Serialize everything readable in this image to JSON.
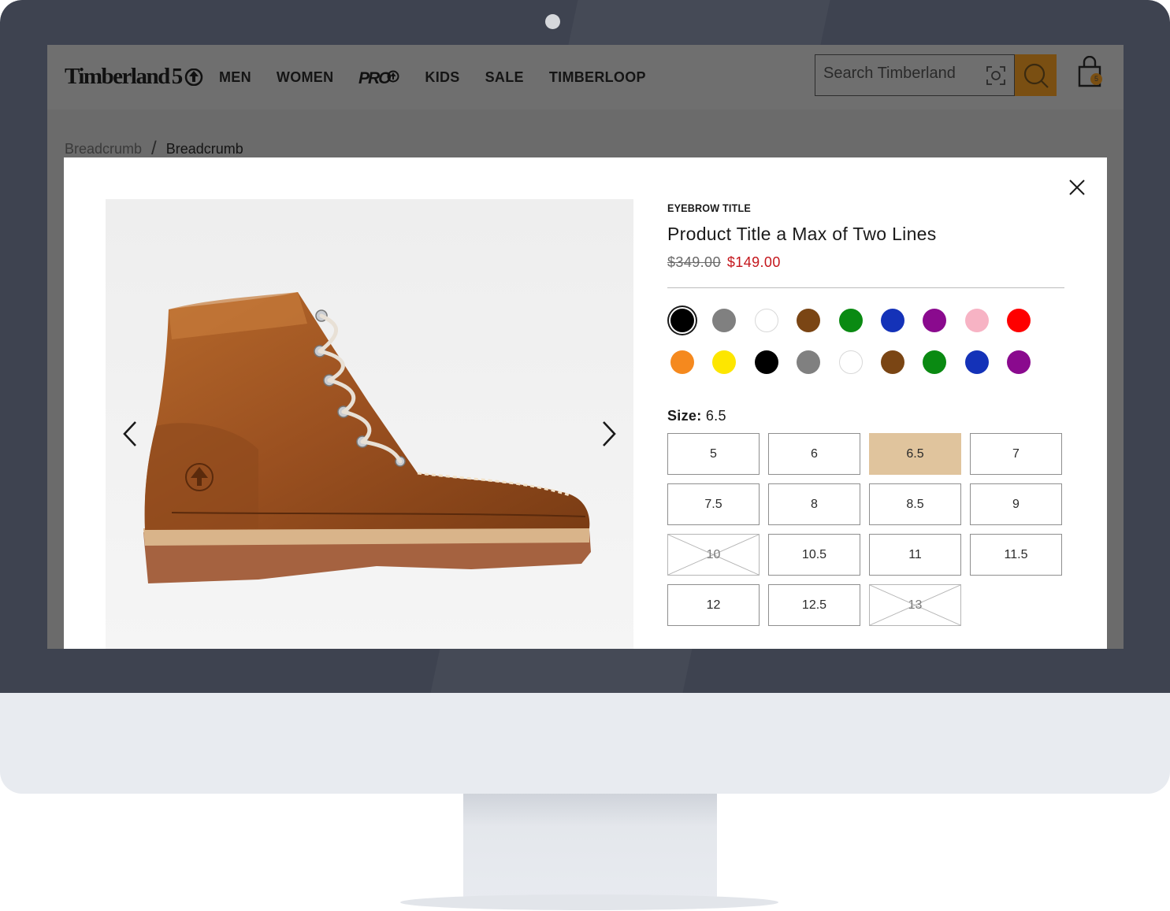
{
  "header": {
    "logo_text": "Timberland",
    "logo_suffix": "5",
    "nav_items": [
      "MEN",
      "WOMEN",
      "KIDS",
      "SALE",
      "TIMBERLOOP"
    ],
    "pro_logo": "PRO",
    "search_placeholder": "Search Timberland",
    "cart_count": "5"
  },
  "breadcrumb": [
    "Breadcrumb",
    "Breadcrumb"
  ],
  "modal": {
    "eyebrow": "EYEBROW TITLE",
    "title": "Product Title a Max of Two Lines",
    "old_price": "$349.00",
    "new_price": "$149.00",
    "colors": {
      "row1": [
        "#000000",
        "#808080",
        "#ffffff",
        "#7a4514",
        "#0a8a12",
        "#1432b8",
        "#8a0a8e",
        "#f7b3c4",
        "#fe0000"
      ],
      "row2": [
        "#f5891e",
        "#fde600",
        "#000000",
        "#808080",
        "#ffffff",
        "#7a4514",
        "#0a8a12",
        "#1432b8",
        "#8a0a8e"
      ],
      "selected_index": 0
    },
    "size_label": "Size:",
    "size_value": "6.5",
    "sizes": [
      "5",
      "6",
      "6.5",
      "7",
      "7.5",
      "8",
      "8.5",
      "9",
      "10",
      "10.5",
      "11",
      "11.5",
      "12",
      "12.5",
      "13"
    ],
    "selected_size": "6.5",
    "unavailable_sizes": [
      "10",
      "13"
    ]
  },
  "colors": {
    "accent": "#7a4f12",
    "sale_red": "#c4161c",
    "selected_size_bg": "#e0c49d"
  },
  "icons": [
    "camera-scan-icon",
    "search-icon",
    "shopping-bag-icon",
    "close-icon",
    "chevron-left-icon",
    "chevron-right-icon",
    "tree-logo-icon"
  ]
}
